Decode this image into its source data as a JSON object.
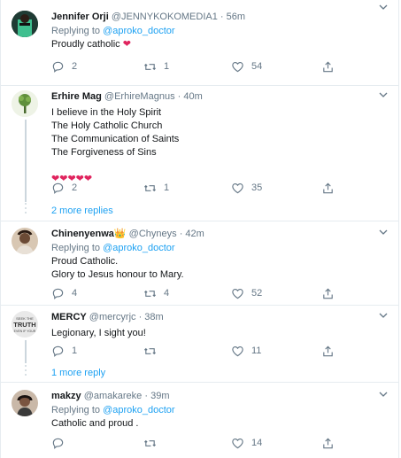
{
  "tweets": [
    {
      "name": "Jennifer Orji",
      "handle": "@JENNYKOKOMEDIA1",
      "time": "· 56m",
      "replying_prefix": "Replying to ",
      "replying_to": "@aproko_doctor",
      "lines": [
        "Proudly catholic ❤️"
      ],
      "replies": "2",
      "retweets": "1",
      "likes": "54",
      "avatar_color": "#2a4a3a"
    },
    {
      "name": "Erhire Mag",
      "handle": "@ErhireMagnus",
      "time": "· 40m",
      "lines": [
        "I believe in the Holy Spirit",
        "The Holy Catholic Church",
        "The Communication of Saints",
        "The Forgiveness of Sins",
        "",
        "❤️❤️❤️❤️❤️"
      ],
      "replies": "2",
      "retweets": "1",
      "likes": "35",
      "avatar_color": "#6b8f4e"
    },
    {
      "more_replies": "2 more replies"
    },
    {
      "name": "Chinenyenwa👑",
      "handle": "@Chyneys",
      "time": "· 42m",
      "replying_prefix": "Replying to ",
      "replying_to": "@aproko_doctor",
      "lines": [
        "Proud Catholic.",
        "Glory to Jesus honour to Mary."
      ],
      "replies": "4",
      "retweets": "4",
      "likes": "52",
      "avatar_color": "#b89a7a"
    },
    {
      "name": "MERCY",
      "handle": "@mercyrjc",
      "time": "· 38m",
      "lines": [
        "Legionary, I sight you!"
      ],
      "replies": "1",
      "retweets": "",
      "likes": "11",
      "avatar_color": "#d9d9d9",
      "avatar_text": "TRUTH"
    },
    {
      "more_replies": "1 more reply"
    },
    {
      "name": "makzy",
      "handle": "@amakareke",
      "time": "· 39m",
      "replying_prefix": "Replying to ",
      "replying_to": "@aproko_doctor",
      "lines": [
        "Catholic and proud ."
      ],
      "replies": "",
      "retweets": "",
      "likes": "14",
      "avatar_color": "#7a5a4a"
    }
  ],
  "colors": {
    "accent": "#1da1f2",
    "muted": "#657786",
    "heart": "#e0245e"
  }
}
